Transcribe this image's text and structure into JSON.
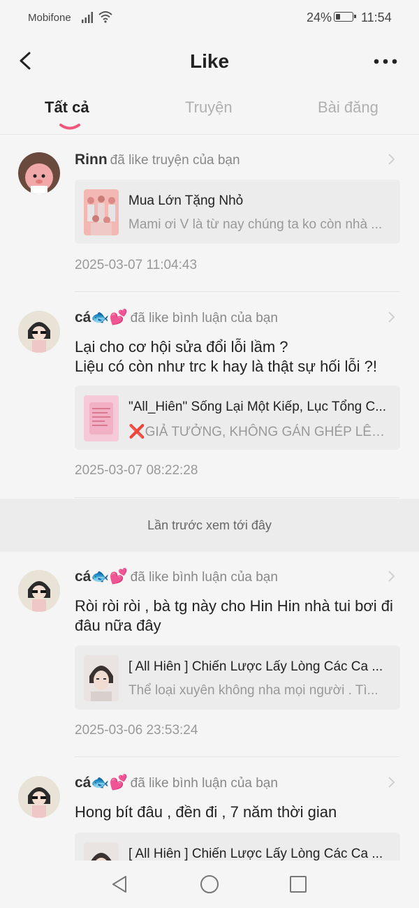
{
  "status_bar": {
    "carrier": "Mobifone",
    "battery": "24%",
    "time": "11:54"
  },
  "header": {
    "title": "Like"
  },
  "tabs": [
    {
      "label": "Tất cả",
      "active": true
    },
    {
      "label": "Truyện",
      "active": false
    },
    {
      "label": "Bài đăng",
      "active": false
    }
  ],
  "items": [
    {
      "user": "Rinn",
      "action": "đã like truyện của bạn",
      "comment": "",
      "card_title": "Mua Lớn Tặng Nhỏ",
      "card_desc": "Mami ơi V là từ nay chúng ta ko còn nhà ...",
      "time": "2025-03-07 11:04:43"
    },
    {
      "user": "cá",
      "user_emoji": "🐟💕",
      "action": "đã like bình luận của bạn",
      "comment": "Lại cho cơ hội sửa đổi lỗi lầm ?\nLiệu có còn như trc k hay là thật sự hối lỗi ?!",
      "card_title": "\"All_Hiên\" Sống Lại Một Kiếp, Lục Tổng C...",
      "card_desc": "❌GIẢ TƯỞNG, KHÔNG GÁN GHÉP LÊN ...",
      "time": "2025-03-07 08:22:28"
    },
    {
      "user": "cá",
      "user_emoji": "🐟💕",
      "action": "đã like bình luận của bạn",
      "comment": "Ròi ròi ròi , bà tg này cho Hin Hin nhà tui bơi đi đâu nữa đây",
      "card_title": "[ All Hiên ] Chiến Lược Lấy Lòng Các Ca ...",
      "card_desc": "Thể loại xuyên không nha mọi người . Tì...",
      "time": "2025-03-06 23:53:24"
    },
    {
      "user": "cá",
      "user_emoji": "🐟💕",
      "action": "đã like bình luận của bạn",
      "comment": "Hong bít đâu , đền đi , 7 năm thời gian",
      "card_title": "[ All Hiên ] Chiến Lược Lấy Lòng Các Ca ...",
      "card_desc": "",
      "time": ""
    }
  ],
  "last_seen_label": "Lần trước xem tới đây",
  "colors": {
    "accent": "#f0577a",
    "background": "#f5f5f5",
    "card": "#ececec"
  }
}
